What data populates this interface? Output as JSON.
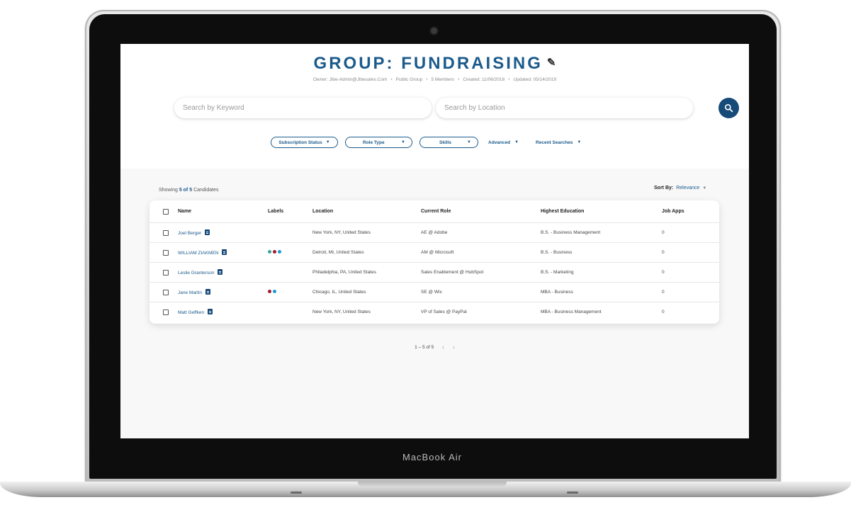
{
  "device": {
    "brand": "MacBook Air"
  },
  "group": {
    "title": "GROUP: FUNDRAISING",
    "owner": "Owner: Jibe-Admin@Jibesales.Com",
    "visibility": "Public Group",
    "members": "5 Members",
    "created": "Created: 11/06/2018",
    "updated": "Updated: 05/14/2019"
  },
  "search": {
    "keyword_placeholder": "Search by Keyword",
    "location_placeholder": "Search by Location"
  },
  "filters": {
    "subscription_status": "Subscription Status",
    "role_type": "Role Type",
    "skills": "Skills",
    "advanced": "Advanced",
    "recent_searches": "Recent Searches"
  },
  "results": {
    "showing_prefix": "Showing",
    "count": "5 of 5",
    "suffix": "Candidates",
    "sort_label": "Sort By:",
    "sort_value": "Relevance"
  },
  "table": {
    "columns": [
      "Name",
      "Labels",
      "Location",
      "Current Role",
      "Highest Education",
      "Job Apps"
    ],
    "rows": [
      {
        "name": "Joel Berger",
        "labels": [],
        "location": "New York, NY, United States",
        "role": "AE @ Adobe",
        "education": "B.S. - Business Management",
        "apps": "0"
      },
      {
        "name": "WILLIAM ZIAKMEN",
        "labels": [
          "#3aa59a",
          "#a3192e",
          "#1a9bd6"
        ],
        "location": "Detroit, MI, United States",
        "role": "AM @ Microsoft",
        "education": "B.S. - Business",
        "apps": "0"
      },
      {
        "name": "Leslie Granterson",
        "labels": [],
        "location": "Philadelphia, PA, United States",
        "role": "Sales Enablement @ HubSpot",
        "education": "B.S. - Marketing",
        "apps": "0"
      },
      {
        "name": "Jane Martin",
        "labels": [
          "#a3192e",
          "#1a9bd6"
        ],
        "location": "Chicago, IL, United States",
        "role": "SE @ Wix",
        "education": "MBA - Business",
        "apps": "0"
      },
      {
        "name": "Matt Geffken",
        "labels": [],
        "location": "New York, NY, United States",
        "role": "VP of Sales @ PayPal",
        "education": "MBA - Business Management",
        "apps": "0"
      }
    ]
  },
  "pagination": {
    "range": "1 – 5 of 5",
    "prev": "‹",
    "next": "›"
  },
  "colors": {
    "primary": "#1b5b8c",
    "search_button": "#164a78"
  },
  "icons": {
    "edit": "pencil-icon",
    "search": "search-icon",
    "note": "note-icon"
  }
}
